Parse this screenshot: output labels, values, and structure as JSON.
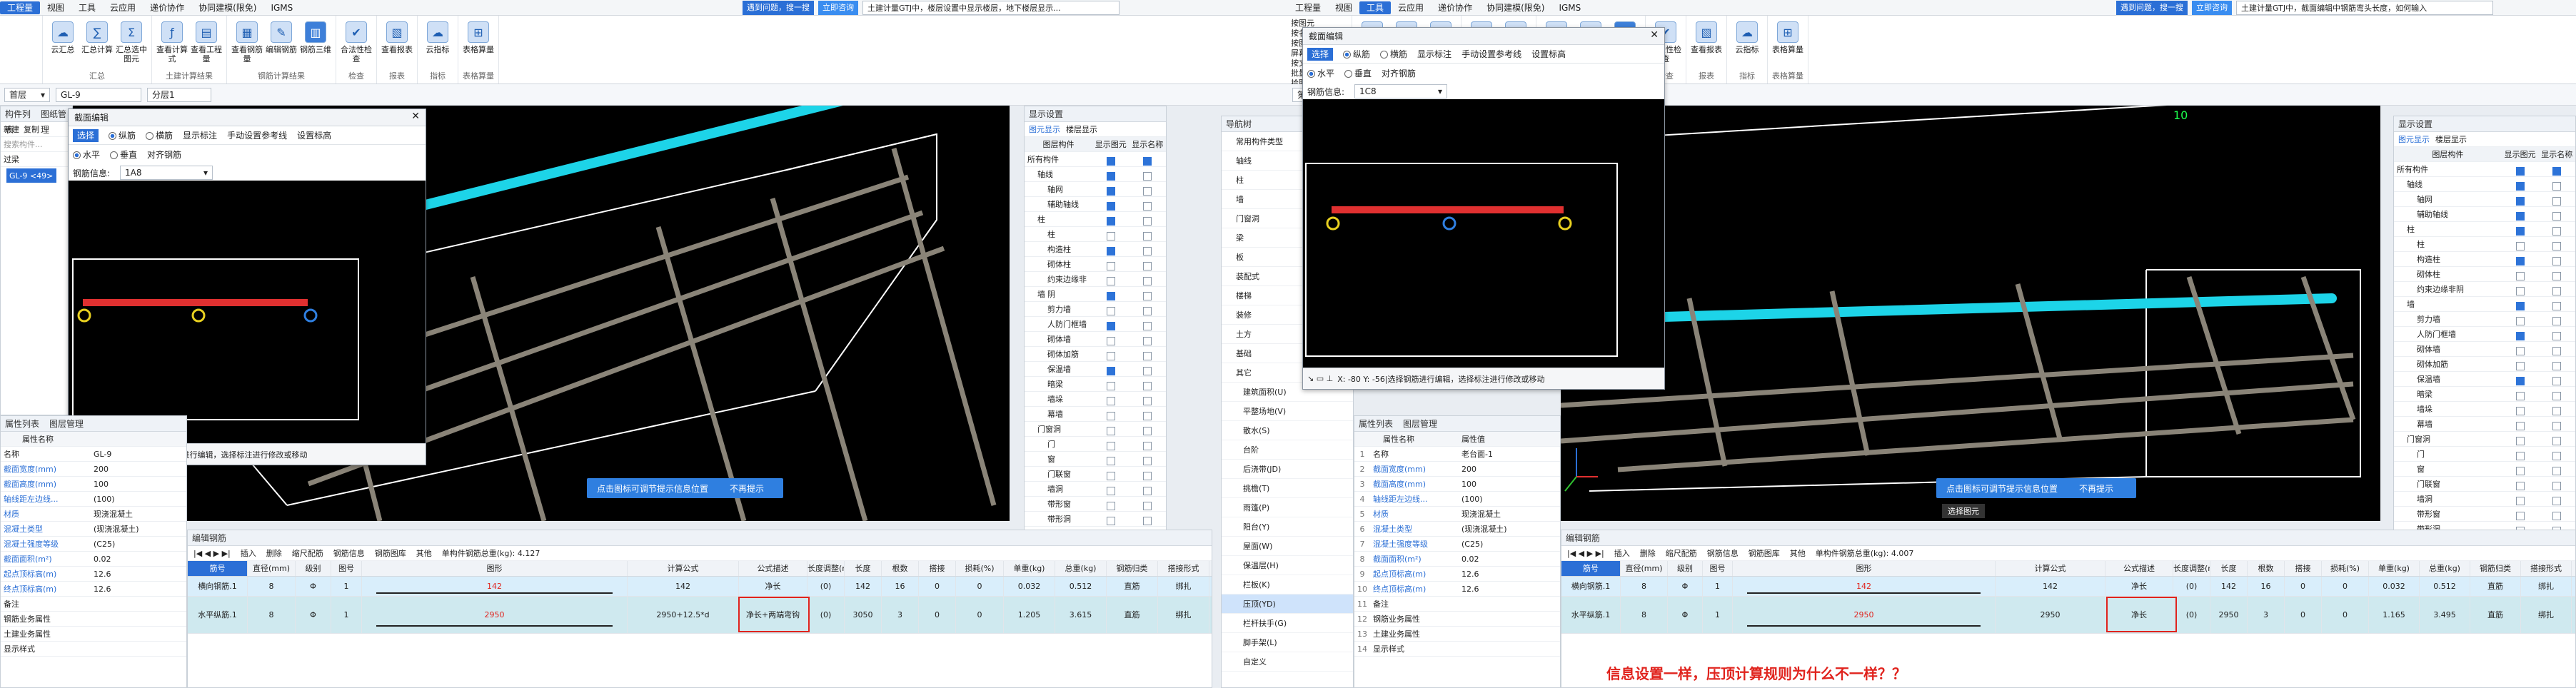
{
  "left": {
    "menu": [
      "工程量",
      "视图",
      "工具",
      "云应用",
      "递价协作",
      "协同建模(限免)",
      "IGMS"
    ],
    "menu_active": 0,
    "ribbon": [
      {
        "label": "汇总",
        "btns": [
          "云汇总",
          "汇总计算",
          "汇总选中图元"
        ]
      },
      {
        "label": "土建计算结果",
        "btns": [
          "查看计算式",
          "查看工程量"
        ]
      },
      {
        "label": "钢筋计算结果",
        "btns": [
          "查看钢筋量",
          "编辑钢筋",
          "钢筋三维"
        ]
      },
      {
        "label": "检查",
        "btns": [
          "合法性检查"
        ]
      },
      {
        "label": "报表",
        "btns": [
          "查看报表"
        ]
      },
      {
        "label": "指标",
        "btns": [
          "云指标"
        ]
      },
      {
        "label": "表格算量",
        "btns": [
          "表格算量"
        ]
      }
    ],
    "notice_label": "遇到问题，搜一搜",
    "notice_btn": "立即咨询",
    "notice_text": "土建计量GTJ中，楼层设置中显示楼层，地下楼层显示...",
    "toolbar": {
      "floor": "首层",
      "item1": "GL-9",
      "item2": "分层1"
    },
    "view_num": "",
    "left_labels": [
      "构件列表",
      "图纸管理",
      "新建",
      "复制",
      "搜索构件...",
      "过梁",
      "GL-9 <49>"
    ],
    "props_title": "属性列表",
    "props_tab2": "图层管理",
    "props_head": "属性名称",
    "props": [
      [
        "名称",
        "GL-9"
      ],
      [
        "截面宽度(mm)",
        "200"
      ],
      [
        "截面高度(mm)",
        "100"
      ],
      [
        "轴线距左边线...",
        "(100)"
      ],
      [
        "材质",
        "现浇混凝土"
      ],
      [
        "混凝土类型",
        "(现浇混凝土)"
      ],
      [
        "混凝土强度等级",
        "(C25)"
      ],
      [
        "截面面积(m²)",
        "0.02"
      ],
      [
        "起点顶标高(m)",
        "12.6"
      ],
      [
        "终点顶标高(m)",
        "12.6"
      ],
      [
        "备注",
        ""
      ],
      [
        "钢筋业务属性",
        ""
      ],
      [
        "土建业务属性",
        ""
      ],
      [
        "显示样式",
        ""
      ]
    ],
    "dialog": {
      "title": "截面编辑",
      "tabs": [
        "选择",
        "纵筋",
        "横筋",
        "显示标注",
        "手动设置参考线",
        "设置标高"
      ],
      "opt1": "水平",
      "opt2": "垂直",
      "opt3": "对齐钢筋",
      "rebar_label": "钢筋信息:",
      "rebar_value": "1A8",
      "status": "X: 51 Y: -39|选择钢筋进行编辑，选择标注进行修改或移动"
    },
    "bluebar_text": "点击图标可调节提示信息位置",
    "bluebar_btn": "不再提示",
    "display": {
      "title": "显示设置",
      "tabs": [
        "图元显示",
        "楼层显示"
      ],
      "heads": [
        "图层构件",
        "显示图元",
        "显示名称"
      ],
      "rows": [
        [
          "所有构件",
          0,
          1,
          1
        ],
        [
          "轴线",
          1,
          1,
          0
        ],
        [
          "轴网",
          2,
          1,
          0
        ],
        [
          "辅助轴线",
          2,
          1,
          0
        ],
        [
          "柱",
          1,
          1,
          0
        ],
        [
          "柱",
          2,
          0,
          0
        ],
        [
          "构造柱",
          2,
          1,
          0
        ],
        [
          "砌体柱",
          2,
          0,
          0
        ],
        [
          "约束边缘非阴",
          2,
          0,
          0
        ],
        [
          "墙",
          1,
          1,
          0
        ],
        [
          "剪力墙",
          2,
          0,
          0
        ],
        [
          "人防门框墙",
          2,
          1,
          0
        ],
        [
          "砌体墙",
          2,
          0,
          0
        ],
        [
          "砌体加筋",
          2,
          0,
          0
        ],
        [
          "保温墙",
          2,
          1,
          0
        ],
        [
          "暗梁",
          2,
          0,
          0
        ],
        [
          "墙垛",
          2,
          0,
          0
        ],
        [
          "幕墙",
          2,
          0,
          0
        ],
        [
          "门窗洞",
          1,
          0,
          0
        ],
        [
          "门",
          2,
          0,
          0
        ],
        [
          "窗",
          2,
          0,
          0
        ],
        [
          "门联窗",
          2,
          0,
          0
        ],
        [
          "墙洞",
          2,
          0,
          0
        ],
        [
          "带形窗",
          2,
          0,
          0
        ],
        [
          "带形洞",
          2,
          0,
          0
        ],
        [
          "飘窗",
          2,
          0,
          0
        ],
        [
          "老虎窗",
          2,
          0,
          0
        ],
        [
          "过梁",
          2,
          1,
          0
        ],
        [
          "壁龛",
          2,
          0,
          0
        ],
        [
          "梁",
          1,
          0,
          0
        ],
        [
          "梁",
          2,
          0,
          0
        ],
        [
          "连梁",
          2,
          0,
          0
        ],
        [
          "圈梁",
          2,
          0,
          0
        ],
        [
          "板",
          1,
          0,
          0
        ]
      ]
    },
    "grid": {
      "title": "编辑钢筋",
      "toolbar": [
        "插入",
        "删除",
        "缩尺配筋",
        "钢筋信息",
        "钢筋图库",
        "其他",
        "单构件钢筋总重(kg): 4.127"
      ],
      "heads": [
        "筋号",
        "直径(mm)",
        "级别",
        "图号",
        "图形",
        "计算公式",
        "公式描述",
        "长度调整(mm)",
        "长度",
        "根数",
        "搭接",
        "损耗(%)",
        "单重(kg)",
        "总重(kg)",
        "钢筋归类",
        "搭接形式"
      ],
      "rows": [
        [
          "横向钢筋.1",
          "8",
          "Φ",
          "1",
          "142",
          "142",
          "净长",
          "(0)",
          "142",
          "16",
          "0",
          "0",
          "0.032",
          "0.512",
          "直筋",
          "绑扎"
        ],
        [
          "水平纵筋.1",
          "8",
          "Φ",
          "1",
          "2950",
          "2950+12.5*d",
          "净长+两端弯钩",
          "(0)",
          "3050",
          "3",
          "0",
          "0",
          "1.205",
          "3.615",
          "直筋",
          "绑扎"
        ]
      ]
    }
  },
  "right": {
    "menu": [
      "工程量",
      "视图",
      "工具",
      "云应用",
      "递价协作",
      "协同建模(限免)",
      "IGMS"
    ],
    "menu_active": 2,
    "ribbon": [
      {
        "label": "汇总",
        "btns": [
          "云汇总",
          "汇总计算",
          "汇总选中图元"
        ]
      },
      {
        "label": "土建计算结果",
        "btns": [
          "查看计算式",
          "查看工程量"
        ]
      },
      {
        "label": "钢筋计算结果",
        "btns": [
          "查看钢筋量",
          "编辑钢筋",
          "钢筋三维"
        ]
      },
      {
        "label": "检查",
        "btns": [
          "合法性检查"
        ]
      },
      {
        "label": "报表",
        "btns": [
          "查看报表"
        ]
      },
      {
        "label": "指标",
        "btns": [
          "云指标"
        ]
      },
      {
        "label": "表格算量",
        "btns": [
          "表格算量"
        ]
      }
    ],
    "side_items": [
      "按图元",
      "按名称",
      "按图纸",
      "屏幕图元",
      "按文字",
      "批量选择",
      "拾取构件",
      "通用操作"
    ],
    "notice_label": "遇到问题，搜一搜",
    "notice_btn": "立即咨询",
    "notice_text": "土建计量GTJ中，截面编辑中钢筋弯头长度，如何输入",
    "toolbar": {
      "floor": "第4层"
    },
    "view_num": "10",
    "nav_title": "导航树",
    "nav": [
      "常用构件类型",
      "轴线",
      "柱",
      "墙",
      "门窗洞",
      "梁",
      "板",
      "装配式",
      "楼梯",
      "装修",
      "土方",
      "基础",
      "其它"
    ],
    "nav_sub": [
      "建筑面积(U)",
      "平整场地(V)",
      "散水(S)",
      "台阶",
      "后浇带(JD)",
      "挑檐(T)",
      "雨篷(P)",
      "阳台(Y)",
      "屋面(W)",
      "保温层(H)",
      "栏板(K)",
      "压顶(YD)",
      "栏杆扶手(G)",
      "脚手架(L)",
      "自定义"
    ],
    "props_title": "属性列表",
    "props_tab2": "图层管理",
    "props_head": "属性名称",
    "props_head2": "属性值",
    "props": [
      [
        "名称",
        "老台面-1"
      ],
      [
        "截面宽度(mm)",
        "200"
      ],
      [
        "截面高度(mm)",
        "100"
      ],
      [
        "轴线距左边线...",
        "(100)"
      ],
      [
        "材质",
        "现浇混凝土"
      ],
      [
        "混凝土类型",
        "(现浇混凝土)"
      ],
      [
        "混凝土强度等级",
        "(C25)"
      ],
      [
        "截面面积(m²)",
        "0.02"
      ],
      [
        "起点顶标高(m)",
        "12.6"
      ],
      [
        "终点顶标高(m)",
        "12.6"
      ],
      [
        "备注",
        ""
      ],
      [
        "钢筋业务属性",
        ""
      ],
      [
        "土建业务属性",
        ""
      ],
      [
        "显示样式",
        ""
      ]
    ],
    "dialog": {
      "title": "截面编辑",
      "tabs": [
        "选择",
        "纵筋",
        "横筋",
        "显示标注",
        "手动设置参考线",
        "设置标高"
      ],
      "opt1": "水平",
      "opt2": "垂直",
      "opt3": "对齐钢筋",
      "rebar_label": "钢筋信息:",
      "rebar_value": "1C8",
      "status": "X: -80 Y: -56|选择钢筋进行编辑，选择标注进行修改或移动"
    },
    "bluebar_text": "点击图标可调节提示信息位置",
    "bluebar_btn": "不再提示",
    "sel_label": "选择图元",
    "display": {
      "title": "显示设置",
      "tabs": [
        "图元显示",
        "楼层显示"
      ],
      "heads": [
        "图层构件",
        "显示图元",
        "显示名称"
      ],
      "rows": [
        [
          "所有构件",
          0,
          1,
          1
        ],
        [
          "轴线",
          1,
          1,
          0
        ],
        [
          "轴网",
          2,
          1,
          0
        ],
        [
          "辅助轴线",
          2,
          1,
          0
        ],
        [
          "柱",
          1,
          1,
          0
        ],
        [
          "柱",
          2,
          0,
          0
        ],
        [
          "构造柱",
          2,
          1,
          0
        ],
        [
          "砌体柱",
          2,
          0,
          0
        ],
        [
          "约束边缘非阴",
          2,
          0,
          0
        ],
        [
          "墙",
          1,
          1,
          0
        ],
        [
          "剪力墙",
          2,
          0,
          0
        ],
        [
          "人防门框墙",
          2,
          1,
          0
        ],
        [
          "砌体墙",
          2,
          0,
          0
        ],
        [
          "砌体加筋",
          2,
          0,
          0
        ],
        [
          "保温墙",
          2,
          1,
          0
        ],
        [
          "暗梁",
          2,
          0,
          0
        ],
        [
          "墙垛",
          2,
          0,
          0
        ],
        [
          "幕墙",
          2,
          0,
          0
        ],
        [
          "门窗洞",
          1,
          0,
          0
        ],
        [
          "门",
          2,
          0,
          0
        ],
        [
          "窗",
          2,
          0,
          0
        ],
        [
          "门联窗",
          2,
          0,
          0
        ],
        [
          "墙洞",
          2,
          0,
          0
        ],
        [
          "带形窗",
          2,
          0,
          0
        ],
        [
          "带形洞",
          2,
          0,
          0
        ],
        [
          "飘窗",
          2,
          0,
          0
        ],
        [
          "老虎窗",
          2,
          0,
          0
        ],
        [
          "过梁",
          2,
          0,
          0
        ],
        [
          "壁龛",
          2,
          0,
          0
        ],
        [
          "梁",
          1,
          0,
          0
        ],
        [
          "梁",
          2,
          0,
          0
        ],
        [
          "连梁",
          2,
          0,
          0
        ],
        [
          "圈梁",
          2,
          0,
          0
        ],
        [
          "板",
          1,
          0,
          0
        ]
      ]
    },
    "grid": {
      "title": "编辑钢筋",
      "toolbar": [
        "插入",
        "删除",
        "缩尺配筋",
        "钢筋信息",
        "钢筋图库",
        "其他",
        "单构件钢筋总重(kg): 4.007"
      ],
      "heads": [
        "筋号",
        "直径(mm)",
        "级别",
        "图号",
        "图形",
        "计算公式",
        "公式描述",
        "长度调整(mm)",
        "长度",
        "根数",
        "搭接",
        "损耗(%)",
        "单重(kg)",
        "总重(kg)",
        "钢筋归类",
        "搭接形式"
      ],
      "rows": [
        [
          "横向钢筋.1",
          "8",
          "Φ",
          "1",
          "142",
          "142",
          "净长",
          "(0)",
          "142",
          "16",
          "0",
          "0",
          "0.032",
          "0.512",
          "直筋",
          "绑扎"
        ],
        [
          "水平纵筋.1",
          "8",
          "Φ",
          "1",
          "2950",
          "2950",
          "净长",
          "(0)",
          "2950",
          "3",
          "0",
          "0",
          "1.165",
          "3.495",
          "直筋",
          "绑扎"
        ]
      ]
    },
    "question": "信息设置一样，压顶计算规则为什么不一样？？"
  }
}
